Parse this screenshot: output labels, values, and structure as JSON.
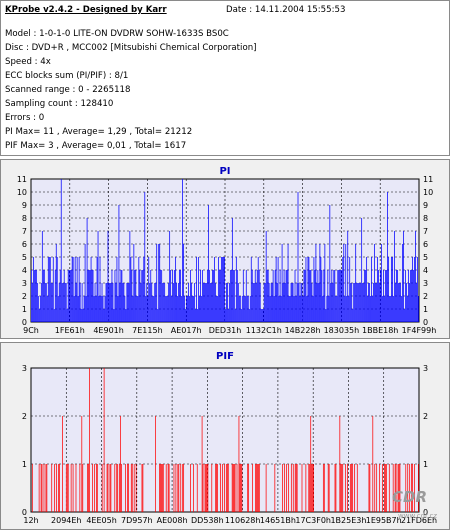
{
  "info": {
    "app_title": "KProbe v2.4.2 - Designed by Karr",
    "date": "Date : 14.11.2004 15:55:53",
    "lines": [
      "Model : 1-0-1-0 LITE-ON DVDRW SOHW-1633S BS0C",
      "Disc : DVD+R , MCC002 [Mitsubishi Chemical Corporation]",
      "Speed : 4x",
      "ECC blocks sum (PI/PIF) : 8/1",
      "Scanned range : 0 - 2265118",
      "Sampling count : 128410",
      "Errors : 0",
      "PI Max= 11 , Average= 1,29 , Total= 21212",
      "PIF Max= 3 , Average= 0,01 , Total= 1617"
    ]
  },
  "pi_chart": {
    "title": "PI",
    "y_ticks": [
      "0",
      "1",
      "2",
      "3",
      "4",
      "5",
      "6",
      "7",
      "8",
      "9",
      "10",
      "11"
    ],
    "x_labels": [
      "9Ch",
      "1FE61h",
      "4E901h",
      "7E115h",
      "AE017h",
      "DED31h",
      "1132C1h",
      "14B228h",
      "183035h",
      "1BBE18h",
      "1F4F99h"
    ],
    "color": "#0000ff",
    "ylim": [
      0,
      11
    ],
    "values": []
  },
  "pif_chart": {
    "title": "PIF",
    "y_ticks": [
      "0",
      "1",
      "2",
      "3"
    ],
    "x_labels": [
      "12h",
      "2094Eh",
      "4EE05h",
      "7D957h",
      "AE008h",
      "DD538h",
      "110628h",
      "14651Bh",
      "17C3F0h",
      "1B25E3h",
      "1E95B7h",
      "21FD6Eh"
    ],
    "color": "#ff0000",
    "ylim": [
      0,
      3
    ],
    "values": []
  },
  "watermark": {
    "logo": "CDR",
    "url": "www.cdr.cz"
  }
}
